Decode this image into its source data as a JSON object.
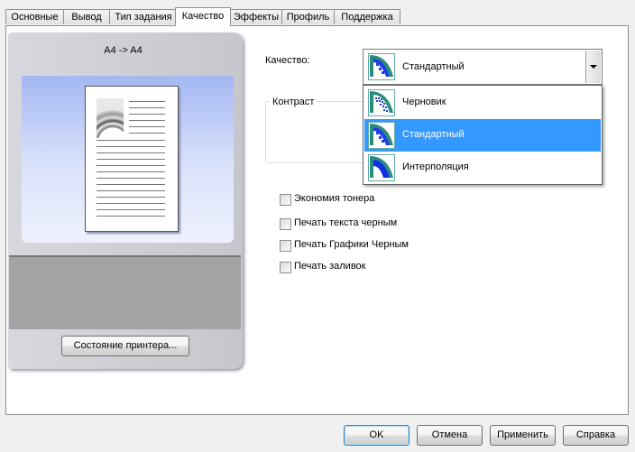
{
  "tabs": [
    {
      "label": "Основные",
      "active": false
    },
    {
      "label": "Вывод",
      "active": false
    },
    {
      "label": "Тип задания",
      "active": false
    },
    {
      "label": "Качество",
      "active": true
    },
    {
      "label": "Эффекты",
      "active": false
    },
    {
      "label": "Профиль",
      "active": false
    },
    {
      "label": "Поддержка",
      "active": false
    }
  ],
  "preview": {
    "paper_size_label": "A4 -> A4",
    "printer_status_button": "Состояние принтера..."
  },
  "quality": {
    "label": "Качество:",
    "selected": "Стандартный",
    "options": [
      {
        "label": "Черновик",
        "icon": "draft-quality-icon",
        "selected": false
      },
      {
        "label": "Стандартный",
        "icon": "standard-quality-icon",
        "selected": true
      },
      {
        "label": "Интерполяция",
        "icon": "interpolation-quality-icon",
        "selected": false
      }
    ]
  },
  "contrast": {
    "label": "Контраст"
  },
  "checkboxes": [
    {
      "label": "Экономия тонера",
      "checked": false
    },
    {
      "label": "Печать текста черным",
      "checked": false
    },
    {
      "label": "Печать Графики Черным",
      "checked": false
    },
    {
      "label": "Печать заливок",
      "checked": false
    }
  ],
  "footer": {
    "ok": "OK",
    "cancel": "Отмена",
    "apply": "Применить",
    "help": "Справка"
  },
  "colors": {
    "selection": "#3399ff",
    "preview_blue": "#a3b7f2",
    "icon_teal": "#3a9a8a",
    "icon_blue": "#1030e0"
  }
}
